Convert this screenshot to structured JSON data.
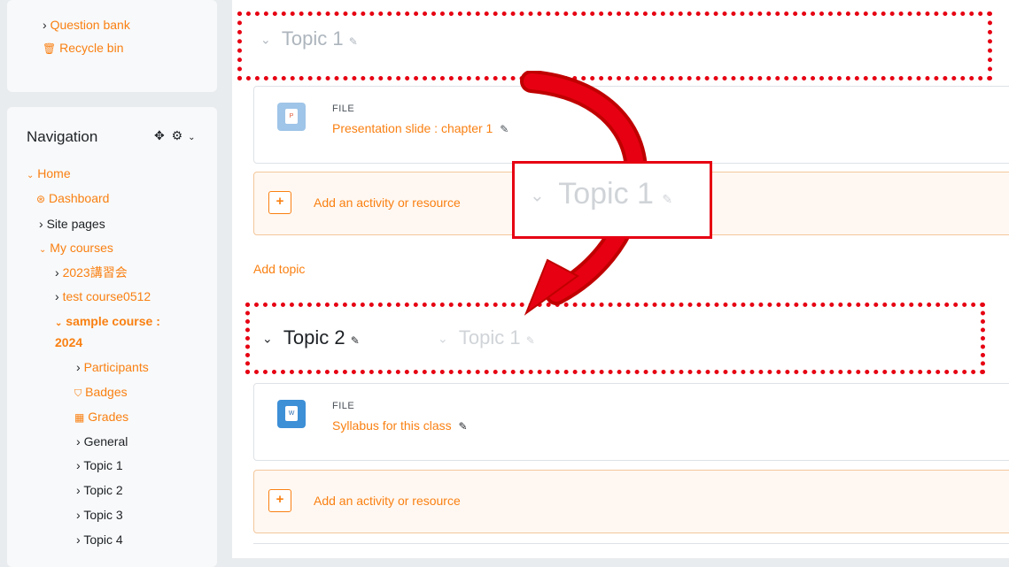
{
  "sidebar": {
    "admin": {
      "question_bank": "Question bank",
      "recycle_bin": "Recycle bin"
    },
    "navigation": {
      "title": "Navigation",
      "items": {
        "home": "Home",
        "dashboard": "Dashboard",
        "site_pages": "Site pages",
        "my_courses": "My courses",
        "course1": "2023講習会",
        "course2": "test course0512",
        "course3_line1": "sample course :",
        "course3_line2": "2024",
        "participants": "Participants",
        "badges": "Badges",
        "grades": "Grades",
        "general": "General",
        "topic1": "Topic 1",
        "topic2": "Topic 2",
        "topic3": "Topic 3",
        "topic4": "Topic 4"
      }
    }
  },
  "main": {
    "section1": {
      "title": "Topic 1",
      "file_type": "FILE",
      "file_name": "Presentation slide : chapter 1",
      "add_label": "Add an activity or resource"
    },
    "dragged_title": "Topic 1",
    "add_topic": "Add topic",
    "section2": {
      "title": "Topic 2",
      "ghost_title": "Topic 1",
      "file_type": "FILE",
      "file_name": "Syllabus for this class",
      "add_label": "Add an activity or resource"
    }
  },
  "colors": {
    "accent": "#f98012",
    "annotation": "#e60012"
  }
}
